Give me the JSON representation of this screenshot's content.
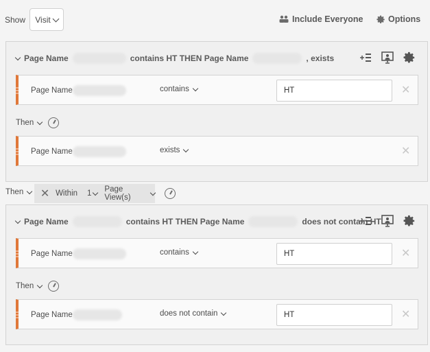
{
  "toolbar": {
    "show_label": "Show",
    "show_value": "Visit",
    "include_everyone": "Include Everyone",
    "options": "Options"
  },
  "containers": [
    {
      "title_prefix": "Page Name",
      "title_mid": "contains HT THEN Page Name",
      "title_suffix": ", exists",
      "rules": [
        {
          "dimension": "Page Name",
          "operator": "contains",
          "value": "HT"
        },
        {
          "dimension": "Page Name",
          "operator": "exists",
          "value": ""
        }
      ],
      "then_label": "Then"
    },
    {
      "title_prefix": "Page Name",
      "title_mid": "contains HT THEN Page Name",
      "title_suffix": "does not contain HT",
      "rules": [
        {
          "dimension": "Page Name",
          "operator": "contains",
          "value": "HT"
        },
        {
          "dimension": "Page Name",
          "operator": "does not contain",
          "value": "HT"
        }
      ],
      "then_label": "Then"
    }
  ],
  "between": {
    "then_label": "Then",
    "within_label": "Within",
    "within_count": "1",
    "within_unit": "Page View(s)"
  },
  "colors": {
    "accent": "#e0783a",
    "background": "#f4f4f4"
  }
}
